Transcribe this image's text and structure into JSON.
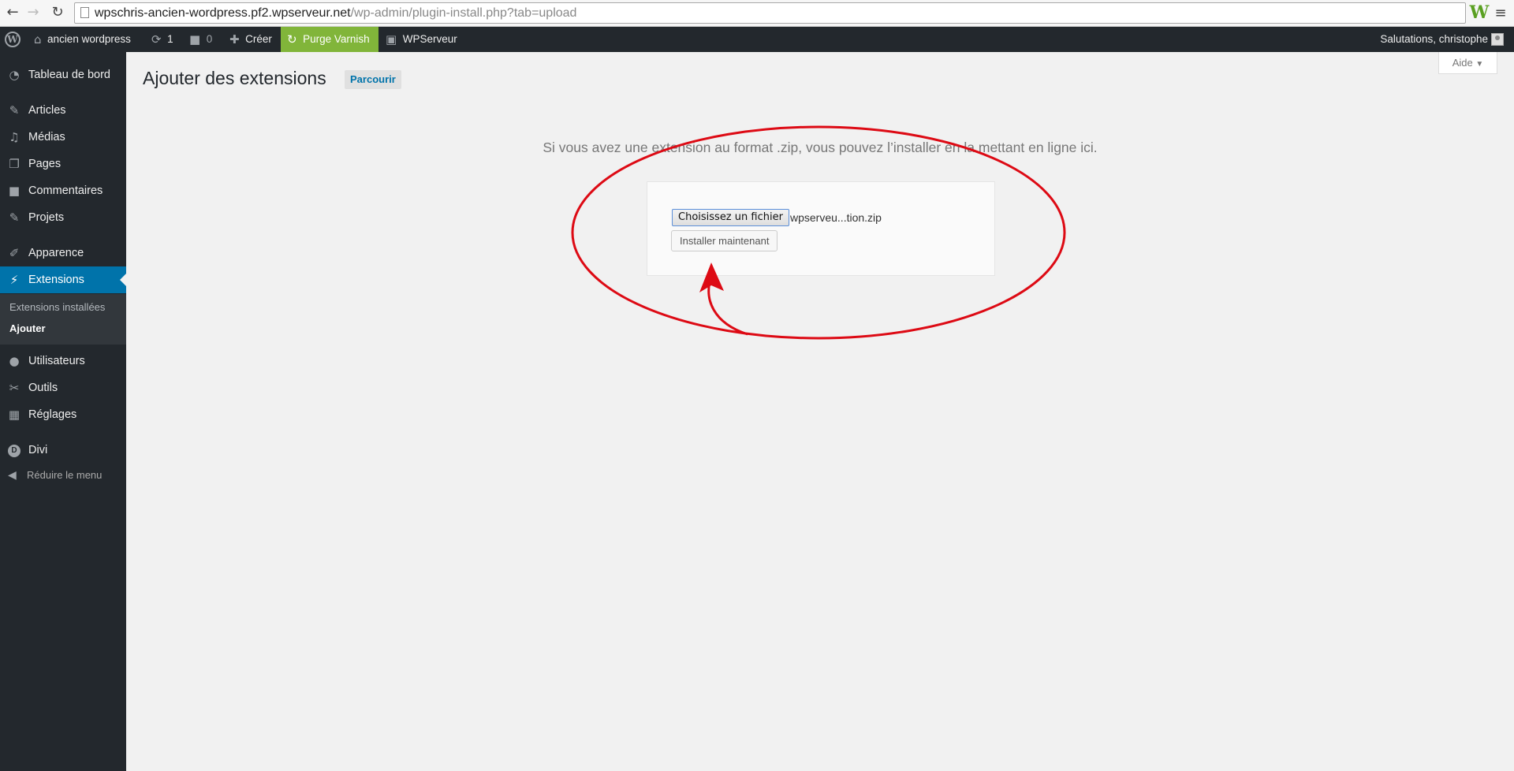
{
  "browser": {
    "url_host": "wpschris-ancien-wordpress.pf2.wpserveur.net",
    "url_path": "/wp-admin/plugin-install.php?tab=upload"
  },
  "adminbar": {
    "site_name": "ancien wordpress",
    "updates_count": "1",
    "comments_count": "0",
    "new_label": "Créer",
    "purge_label": "Purge Varnish",
    "wpserveur_label": "WPServeur",
    "account_label": "Salutations, christophe",
    "purge_color": "#81b53a"
  },
  "sidebar": {
    "dashboard": "Tableau de bord",
    "posts": "Articles",
    "media": "Médias",
    "pages": "Pages",
    "comments": "Commentaires",
    "projects": "Projets",
    "appearance": "Apparence",
    "plugins": "Extensions",
    "submenu": {
      "installed": "Extensions installées",
      "add": "Ajouter"
    },
    "users": "Utilisateurs",
    "tools": "Outils",
    "settings": "Réglages",
    "divi": "Divi",
    "collapse": "Réduire le menu",
    "active_color": "#0073aa"
  },
  "main": {
    "help_tab": "Aide",
    "title": "Ajouter des extensions",
    "browse_button": "Parcourir",
    "upload_help": "Si vous avez une extension au format .zip, vous pouvez l’installer en la mettant en ligne ici.",
    "file_button": "Choisissez un fichier",
    "file_name": "wpserveu...tion.zip",
    "install_button": "Installer maintenant"
  },
  "annotation": {
    "color": "#dd0a14"
  }
}
